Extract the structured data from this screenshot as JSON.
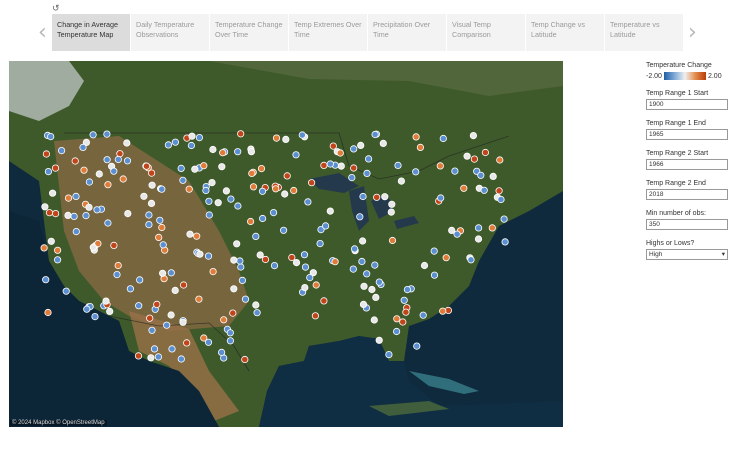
{
  "toolbar": {
    "undo_icon": "undo-icon"
  },
  "tabs": [
    {
      "label": "Change in Average Temperature Map",
      "active": true
    },
    {
      "label": "Daily Temperature Observations"
    },
    {
      "label": "Temperature Change Over Time"
    },
    {
      "label": "Temp Extremes Over Time"
    },
    {
      "label": "Precipitation Over Time"
    },
    {
      "label": "Visual Temp Comparison"
    },
    {
      "label": "Temp Change vs Latitude"
    },
    {
      "label": "Temperature vs Latitude"
    }
  ],
  "nav": {
    "prev": "‹",
    "next": "›"
  },
  "legend": {
    "title": "Temperature Change",
    "min": "-2.00",
    "max": "2.00"
  },
  "params": [
    {
      "label": "Temp Range 1 Start",
      "value": "1900"
    },
    {
      "label": "Temp Range 1 End",
      "value": "1965"
    },
    {
      "label": "Temp Range 2 Start",
      "value": "1966"
    },
    {
      "label": "Temp Range 2 End",
      "value": "2018"
    },
    {
      "label": "Min number of obs:",
      "value": "350"
    }
  ],
  "highs_lows": {
    "label": "Highs or Lows?",
    "value": "High"
  },
  "map": {
    "attribution": "© 2024 Mapbox  © OpenStreetMap"
  },
  "colors": {
    "cool": "#5b8fd0",
    "neutral": "#e8e8e8",
    "warm": "#e07c3a",
    "hot": "#c0451a"
  }
}
